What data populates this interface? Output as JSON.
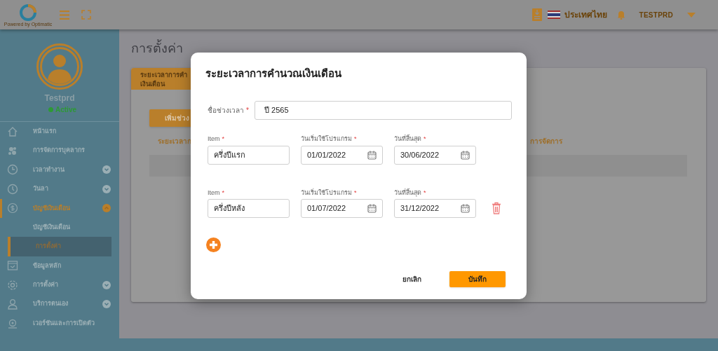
{
  "header": {
    "logo_caption": "Powered by Optimatic",
    "language": "ประเทศไทย",
    "user": "TESTPRD"
  },
  "sidebar": {
    "profile": {
      "name": "Testprd",
      "status": "Active"
    },
    "items": [
      {
        "label": "หน้าแรก",
        "selected": false
      },
      {
        "label": "การจัดการบุคลากร",
        "selected": false
      },
      {
        "label": "เวลาทำงาน",
        "selected": false,
        "expanded": false
      },
      {
        "label": "วันลา",
        "selected": false,
        "expanded": false
      },
      {
        "label": "บัญชีเงินเดือน",
        "selected": true,
        "expanded": true,
        "children": [
          {
            "label": "บัญชีเงินเดือน",
            "selected": false
          },
          {
            "label": "การตั้งค่า",
            "selected": true
          }
        ]
      },
      {
        "label": "ข้อมูลหลัก",
        "selected": false
      },
      {
        "label": "การตั้งค่า",
        "selected": false,
        "expanded": false
      },
      {
        "label": "บริการตนเอง",
        "selected": false,
        "expanded": false
      },
      {
        "label": "เวอร์ชันและการเปิดตัว",
        "selected": false
      }
    ]
  },
  "page": {
    "title": "การตั้งค่า",
    "tabs": [
      {
        "label": "ระยะเวลาการคำ\nเงินเดือน",
        "selected": true
      }
    ],
    "add_button": "เพิ่มช่วง",
    "table": {
      "columns": [
        "ระยะเวลาก",
        "การจัดการ"
      ]
    }
  },
  "dialog": {
    "title": "ระยะเวลาการคำนวณเงินเดือน",
    "name_field": {
      "label": "ชื่อช่วงเวลา",
      "required_mark": "*",
      "value": "ปี 2565"
    },
    "periods": [
      {
        "removable": false,
        "fields": [
          {
            "kind": "text",
            "label": "Item",
            "required_mark": "*",
            "value": "ครึ่งปีแรก"
          },
          {
            "kind": "date",
            "label": "วันเริ่มใช้โปรแกรม",
            "required_mark": "*",
            "value": "01/01/2022"
          },
          {
            "kind": "date",
            "label": "วันที่สิ้นสุด",
            "required_mark": "*",
            "value": "30/06/2022"
          }
        ]
      },
      {
        "removable": true,
        "fields": [
          {
            "kind": "text",
            "label": "Item",
            "required_mark": "*",
            "value": "ครึ่งปีหลัง"
          },
          {
            "kind": "date",
            "label": "วันเริ่มใช้โปรแกรม",
            "required_mark": "*",
            "value": "01/07/2022"
          },
          {
            "kind": "date",
            "label": "วันที่สิ้นสุด",
            "required_mark": "*",
            "value": "31/12/2022"
          }
        ]
      }
    ],
    "buttons": [
      {
        "label": "ยกเลิก",
        "kind": "text"
      },
      {
        "label": "บันทึก",
        "kind": "primary"
      }
    ]
  }
}
